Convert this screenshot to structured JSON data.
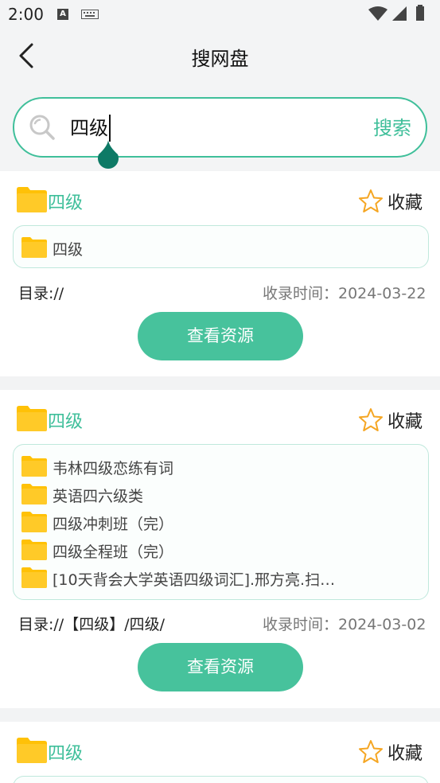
{
  "status": {
    "time": "2:00",
    "a_badge": "A"
  },
  "header": {
    "title": "搜网盘"
  },
  "search": {
    "query": "四级",
    "button_label": "搜索"
  },
  "results": [
    {
      "title": "四级",
      "favorite_label": "收藏",
      "files": [
        "四级"
      ],
      "directory": "目录://",
      "time_label": "收录时间：2024-03-22",
      "view_label": "查看资源"
    },
    {
      "title": "四级",
      "favorite_label": "收藏",
      "files": [
        "韦林四级恋练有词",
        "英语四六级类",
        "四级冲刺班（完）",
        "四级全程班（完）",
        "[10天背会大学英语四级词汇].邢方亮.扫…"
      ],
      "directory": "目录://【四级】/四级/",
      "time_label": "收录时间：2024-03-02",
      "view_label": "查看资源"
    },
    {
      "title": "四级",
      "favorite_label": "收藏"
    }
  ],
  "colors": {
    "accent": "#3fbf9a",
    "button": "#47c29c",
    "folder": "#ffc107"
  }
}
